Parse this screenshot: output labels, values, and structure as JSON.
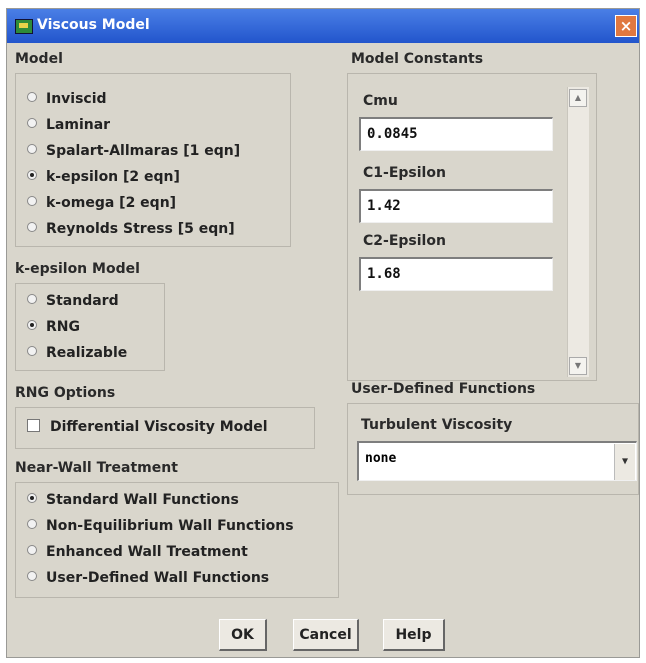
{
  "window": {
    "title": "Viscous Model",
    "close_glyph": "×"
  },
  "model": {
    "label": "Model",
    "options": [
      {
        "label": "Inviscid",
        "selected": false
      },
      {
        "label": "Laminar",
        "selected": false
      },
      {
        "label": "Spalart-Allmaras  [1 eqn]",
        "selected": false
      },
      {
        "label": "k-epsilon  [2 eqn]",
        "selected": true
      },
      {
        "label": "k-omega  [2 eqn]",
        "selected": false
      },
      {
        "label": "Reynolds Stress  [5 eqn]",
        "selected": false
      }
    ]
  },
  "kepsilon_model": {
    "label": "k-epsilon Model",
    "options": [
      {
        "label": "Standard",
        "selected": false
      },
      {
        "label": "RNG",
        "selected": true
      },
      {
        "label": "Realizable",
        "selected": false
      }
    ]
  },
  "rng_options": {
    "label": "RNG Options",
    "differential_viscosity": {
      "label": "Differential Viscosity Model",
      "checked": false
    }
  },
  "near_wall": {
    "label": "Near-Wall Treatment",
    "options": [
      {
        "label": "Standard Wall Functions",
        "selected": true
      },
      {
        "label": "Non-Equilibrium Wall Functions",
        "selected": false
      },
      {
        "label": "Enhanced Wall Treatment",
        "selected": false
      },
      {
        "label": "User-Defined Wall Functions",
        "selected": false
      }
    ]
  },
  "model_constants": {
    "label": "Model Constants",
    "fields": [
      {
        "label": "Cmu",
        "value": "0.0845"
      },
      {
        "label": "C1-Epsilon",
        "value": "1.42"
      },
      {
        "label": "C2-Epsilon",
        "value": "1.68"
      }
    ]
  },
  "udf": {
    "label": "User-Defined Functions",
    "turbulent_viscosity": {
      "label": "Turbulent Viscosity",
      "value": "none"
    }
  },
  "buttons": {
    "ok": "OK",
    "cancel": "Cancel",
    "help": "Help"
  },
  "colors": {
    "title_bar": "#2255cc",
    "dialog_bg": "#d9d6cc",
    "close_button": "#e07840"
  },
  "icons": {
    "title": "viscous-model-app-icon",
    "scroll_up": "triangle-up",
    "scroll_down": "triangle-down",
    "dropdown": "triangle-down"
  }
}
